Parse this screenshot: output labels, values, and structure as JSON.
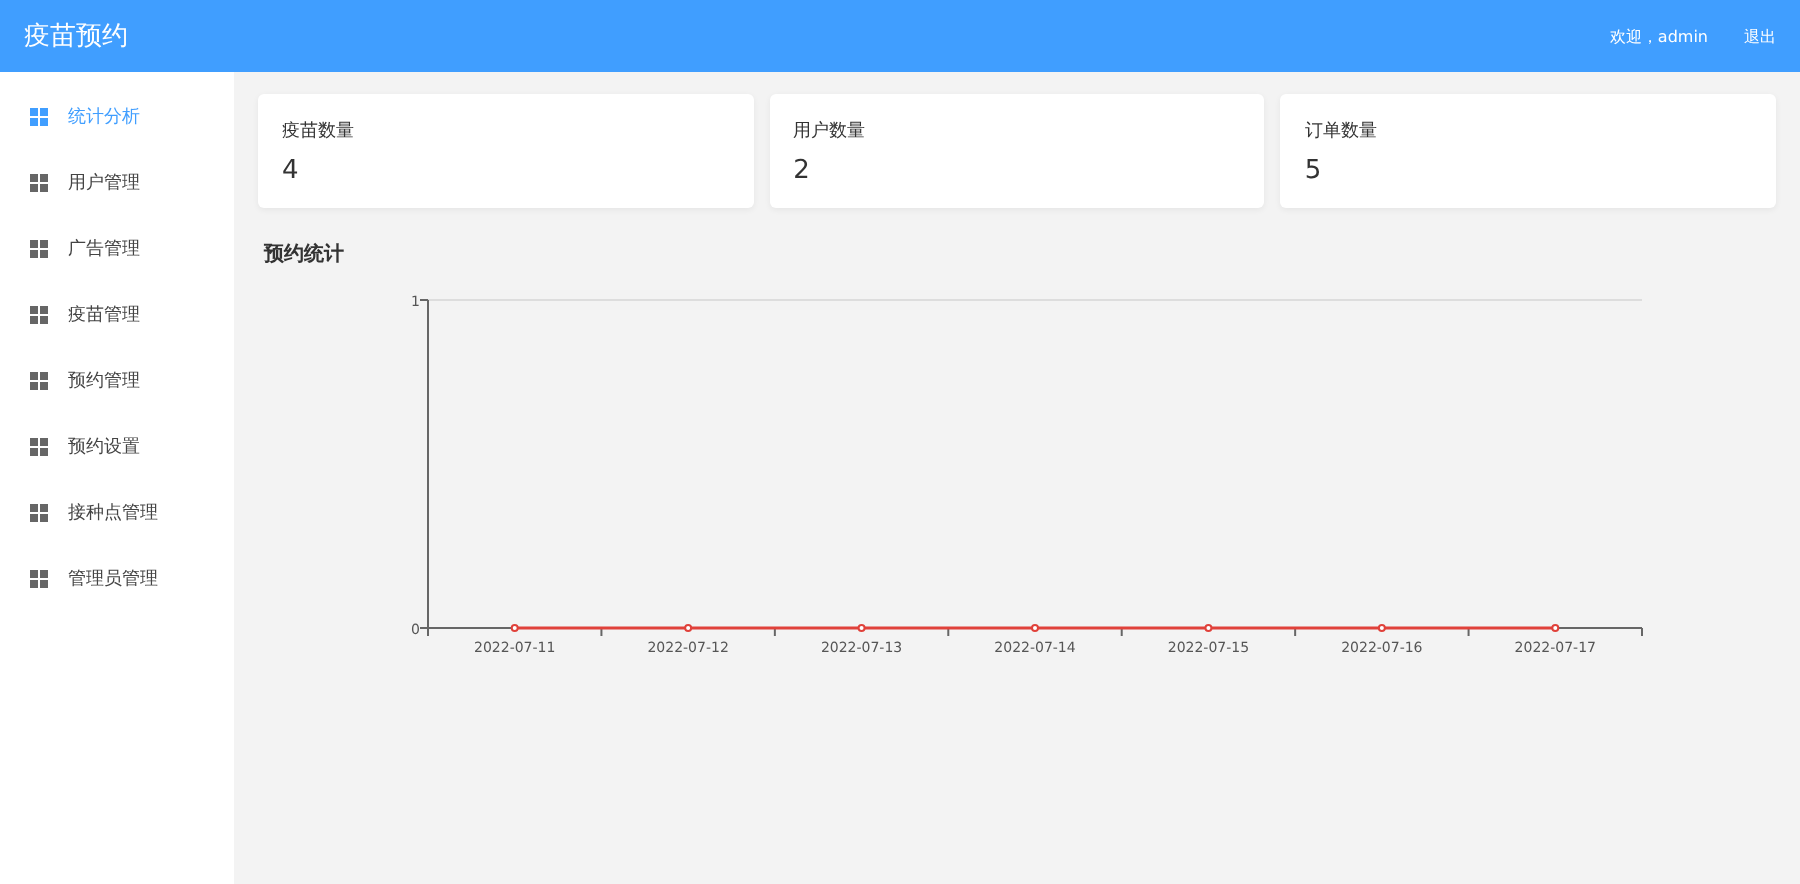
{
  "header": {
    "title": "疫苗预约",
    "welcome": "欢迎，admin",
    "logout": "退出"
  },
  "sidebar": {
    "items": [
      {
        "label": "统计分析",
        "selected": true
      },
      {
        "label": "用户管理",
        "selected": false
      },
      {
        "label": "广告管理",
        "selected": false
      },
      {
        "label": "疫苗管理",
        "selected": false
      },
      {
        "label": "预约管理",
        "selected": false
      },
      {
        "label": "预约设置",
        "selected": false
      },
      {
        "label": "接种点管理",
        "selected": false
      },
      {
        "label": "管理员管理",
        "selected": false
      }
    ]
  },
  "stats": [
    {
      "label": "疫苗数量",
      "value": "4"
    },
    {
      "label": "用户数量",
      "value": "2"
    },
    {
      "label": "订单数量",
      "value": "5"
    }
  ],
  "chart_section": {
    "title": "预约统计",
    "chart_data": {
      "type": "line",
      "categories": [
        "2022-07-11",
        "2022-07-12",
        "2022-07-13",
        "2022-07-14",
        "2022-07-15",
        "2022-07-16",
        "2022-07-17"
      ],
      "series": [
        {
          "color": "#e0413a",
          "marker": "circle",
          "values": [
            0,
            0,
            0,
            0,
            0,
            0,
            0
          ]
        }
      ],
      "ylim": [
        0,
        1
      ],
      "yticks": [
        0,
        1
      ]
    }
  }
}
